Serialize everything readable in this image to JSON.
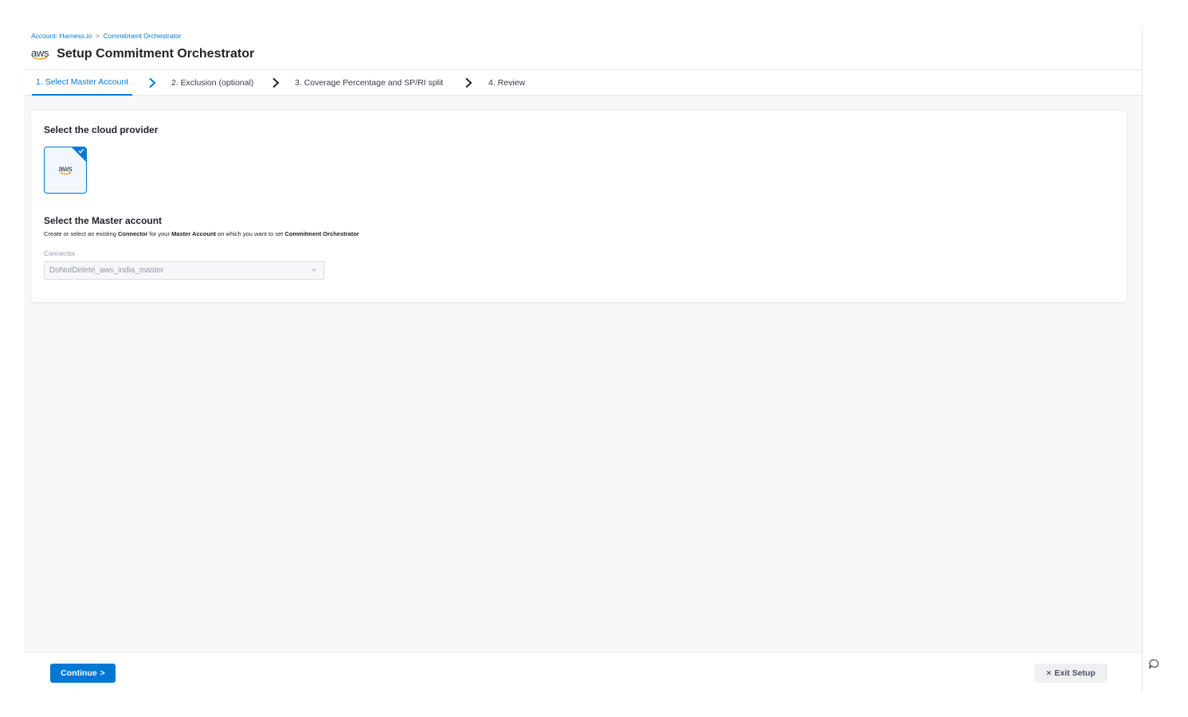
{
  "breadcrumb": {
    "account": "Account: Harness.io",
    "separator": ">",
    "page": "Commitment Orchestrator"
  },
  "header": {
    "logo_text": "aws",
    "title": "Setup Commitment Orchestrator"
  },
  "tabs": [
    {
      "label": "1. Select Master Account",
      "active": true
    },
    {
      "label": "2. Exclusion (optional)",
      "active": false
    },
    {
      "label": "3. Coverage Percentage and SP/RI split",
      "active": false
    },
    {
      "label": "4. Review",
      "active": false
    }
  ],
  "provider_section": {
    "title": "Select the cloud provider",
    "selected_provider": "aws",
    "selected_icon": "check-icon"
  },
  "master_section": {
    "title": "Select the Master account",
    "desc_1": "Create or select an existing ",
    "desc_b1": "Connector",
    "desc_2": " for your ",
    "desc_b2": "Master Account",
    "desc_3": " on which you want to set ",
    "desc_b3": "Commitment Orchestrator",
    "connector_label": "Connector",
    "connector_value": "DoNotDelete_aws_india_master"
  },
  "footer": {
    "continue_label": "Continue",
    "continue_icon": ">",
    "exit_icon": "×",
    "exit_label": "Exit Setup"
  },
  "colors": {
    "accent": "#0278d5",
    "aws_orange": "#ff9900",
    "content_bg": "#f8f8fb"
  }
}
